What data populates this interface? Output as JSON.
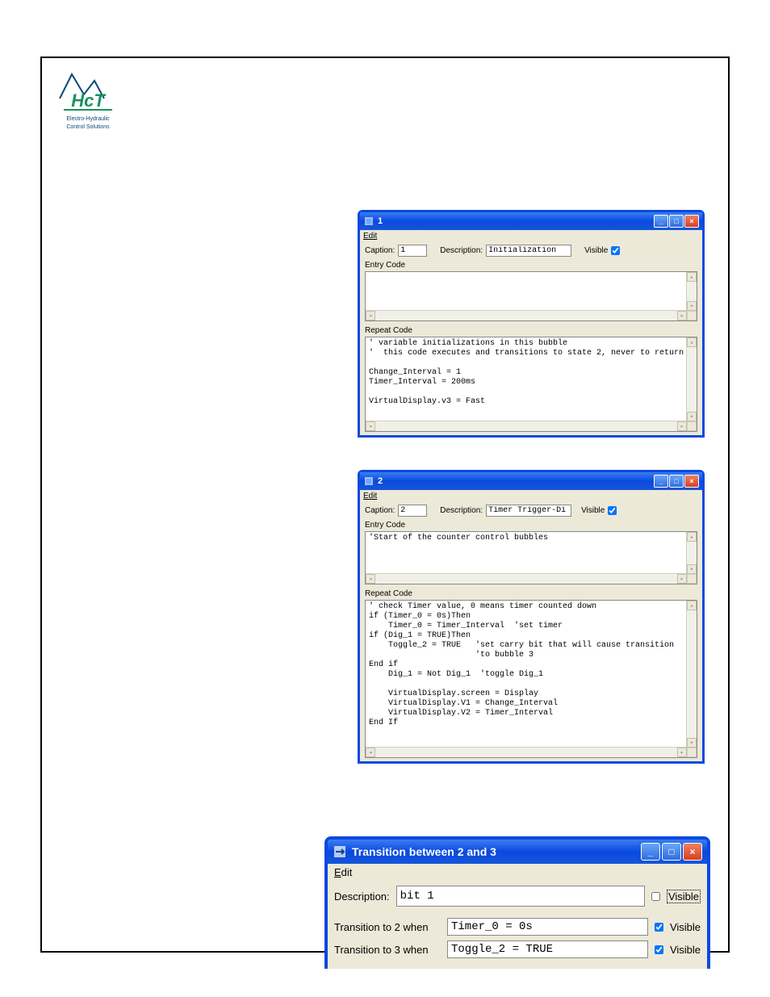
{
  "logo": {
    "brand": "HcT",
    "tagline1": "Electro-Hydraulic",
    "tagline2": "Control Solutions"
  },
  "window1": {
    "title": "1",
    "edit_menu": "Edit",
    "caption_label": "Caption:",
    "caption_value": "1",
    "description_label": "Description:",
    "description_value": "Initialization",
    "visible_label": "Visible",
    "visible_checked": true,
    "entry_code_label": "Entry Code",
    "entry_code_text": "",
    "repeat_code_label": "Repeat Code",
    "repeat_code_text": "' variable initializations in this bubble\n'  this code executes and transitions to state 2, never to return\n\nChange_Interval = 1\nTimer_Interval = 200ms\n\nVirtualDisplay.v3 = Fast"
  },
  "window2": {
    "title": "2",
    "edit_menu": "Edit",
    "caption_label": "Caption:",
    "caption_value": "2",
    "description_label": "Description:",
    "description_value": "Timer Trigger-Di",
    "visible_label": "Visible",
    "visible_checked": true,
    "entry_code_label": "Entry Code",
    "entry_code_text": "'Start of the counter control bubbles",
    "repeat_code_label": "Repeat Code",
    "repeat_code_text": "' check Timer value, 0 means timer counted down\nif (Timer_0 = 0s)Then\n    Timer_0 = Timer_Interval  'set timer\nif (Dig_1 = TRUE)Then\n    Toggle_2 = TRUE   'set carry bit that will cause transition\n                      'to bubble 3\nEnd if\n    Dig_1 = Not Dig_1  'toggle Dig_1\n\n    VirtualDisplay.screen = Display\n    VirtualDisplay.V1 = Change_Interval\n    VirtualDisplay.V2 = Timer_Interval\nEnd If"
  },
  "window3": {
    "title": "Transition between 2 and 3",
    "edit_menu": "Edit",
    "description_label": "Description:",
    "description_value": "bit 1",
    "desc_visible_label": "Visible",
    "desc_visible_checked": false,
    "trans2_label": "Transition to 2 when",
    "trans2_value": "Timer_0 = 0s",
    "trans2_visible_label": "Visible",
    "trans2_visible_checked": true,
    "trans3_label": "Transition to 3 when",
    "trans3_value": "Toggle_2 = TRUE",
    "trans3_visible_label": "Visible",
    "trans3_visible_checked": true
  }
}
